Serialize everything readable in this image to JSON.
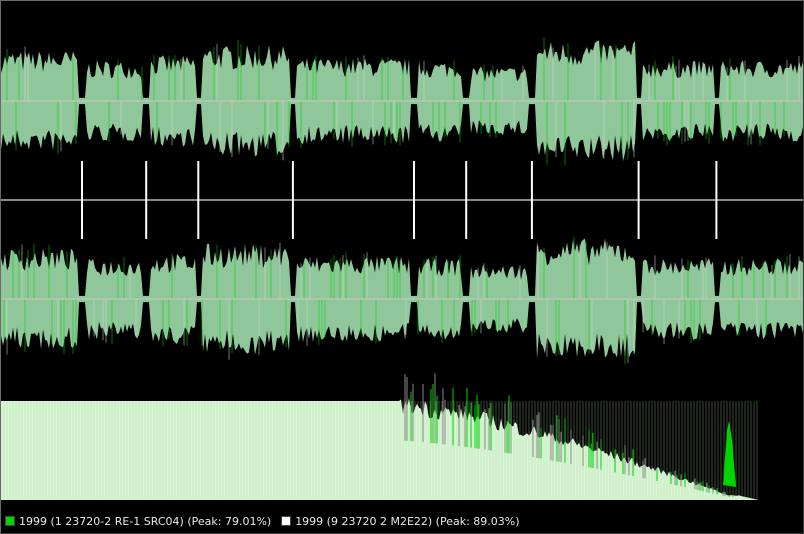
{
  "colors": {
    "background": "#000000",
    "track_a": "#00d400",
    "track_b": "#ffffff",
    "overlap_fill": "#8fc79a",
    "spectrum_fill": "#d9f5d6",
    "centerline": "#b8c8b8",
    "divider": "#8a8a8a"
  },
  "legend": {
    "items": [
      {
        "color": "#00d400",
        "label": "1999 (1 23720-2 RE-1 SRC04) (Peak: 79.01%)"
      },
      {
        "color": "#ffffff",
        "label": "1999 (9 23720 2 M2E22) (Peak: 89.03%)"
      }
    ]
  },
  "tracks": {
    "segment_gaps_fraction": [
      0.101,
      0.181,
      0.246,
      0.364,
      0.515,
      0.58,
      0.662,
      0.795,
      0.892
    ],
    "segment_levels_fraction": [
      0.82,
      0.66,
      0.74,
      0.9,
      0.7,
      0.66,
      0.56,
      0.98,
      0.66,
      0.66
    ]
  }
}
